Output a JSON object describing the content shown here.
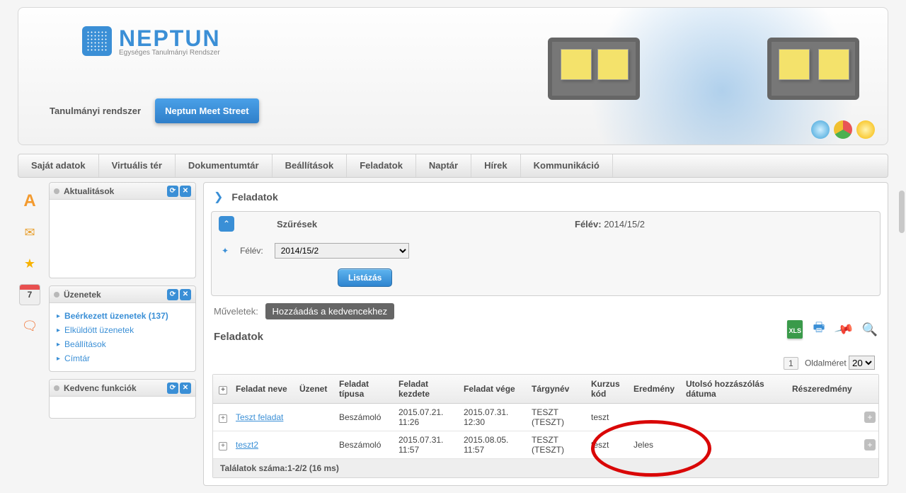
{
  "branding": {
    "name": "NEPTUN",
    "subtitle": "Egységes Tanulmányi Rendszer"
  },
  "top_tabs": {
    "study": "Tanulmányi rendszer",
    "meet": "Neptun Meet Street"
  },
  "menu": {
    "sajat": "Saját adatok",
    "virt": "Virtuális tér",
    "dok": "Dokumentumtár",
    "beall": "Beállítások",
    "felad": "Feladatok",
    "naptar": "Naptár",
    "hirek": "Hírek",
    "komm": "Kommunikáció"
  },
  "rail": {
    "a": "A",
    "cal": "7"
  },
  "side_panels": {
    "aktual": {
      "title": "Aktualitások"
    },
    "uzen": {
      "title": "Üzenetek",
      "inbox": "Beérkezett üzenetek (137)",
      "sent": "Elküldött üzenetek",
      "settings": "Beállítások",
      "dir": "Címtár"
    },
    "fav": {
      "title": "Kedvenc funkciók"
    }
  },
  "content": {
    "breadcrumb": "Feladatok",
    "filters_label": "Szűrések",
    "semester_head_label": "Félév:",
    "semester_head_value": "2014/15/2",
    "semester_label": "Félév:",
    "semester_value": "2014/15/2",
    "list_btn": "Listázás",
    "ops_label": "Műveletek:",
    "ops_add_fav": "Hozzáadás a kedvencekhez",
    "section": "Feladatok",
    "xls": "XLS",
    "pager": {
      "page": "1",
      "size_label": "Oldalméret",
      "size": "20"
    },
    "columns": {
      "name": "Feladat neve",
      "msg": "Üzenet",
      "type": "Feladat típusa",
      "start": "Feladat kezdete",
      "end": "Feladat vége",
      "subject": "Tárgynév",
      "course": "Kurzus kód",
      "result": "Eredmény",
      "lastcomment": "Utolsó hozzászólás dátuma",
      "partial": "Részeredmény"
    },
    "rows": [
      {
        "name": "Teszt feladat",
        "msg": "",
        "type": "Beszámoló",
        "start": "2015.07.21. 11:26",
        "end": "2015.07.31. 12:30",
        "subject": "TESZT (TESZT)",
        "course": "teszt",
        "result": "",
        "lastcomment": "",
        "partial": ""
      },
      {
        "name": "teszt2",
        "msg": "",
        "type": "Beszámoló",
        "start": "2015.07.31. 11:57",
        "end": "2015.08.05. 11:57",
        "subject": "TESZT (TESZT)",
        "course": "teszt",
        "result": "Jeles",
        "lastcomment": "",
        "partial": ""
      }
    ],
    "footer": "Találatok száma:1-2/2 (16 ms)"
  }
}
